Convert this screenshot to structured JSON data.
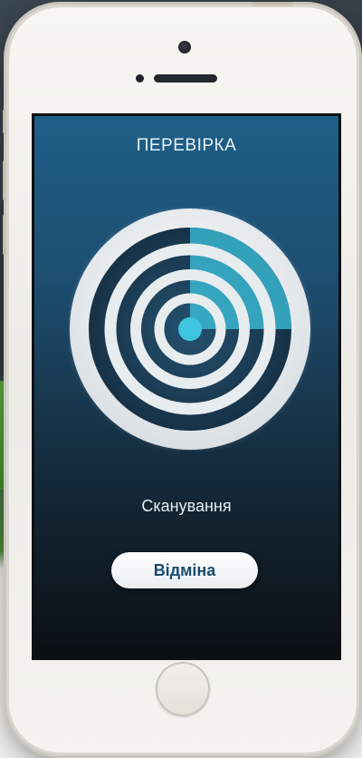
{
  "screen": {
    "title": "ПЕРЕВІРКА",
    "status_text": "Сканування",
    "cancel_label": "Відміна"
  },
  "colors": {
    "accent": "#3ec6e0",
    "screen_top": "#1f5f88",
    "screen_bottom": "#0b0f14",
    "button_text": "#1b4b6e"
  },
  "icons": {
    "radar": "radar-scan-icon",
    "home": "home-button"
  }
}
